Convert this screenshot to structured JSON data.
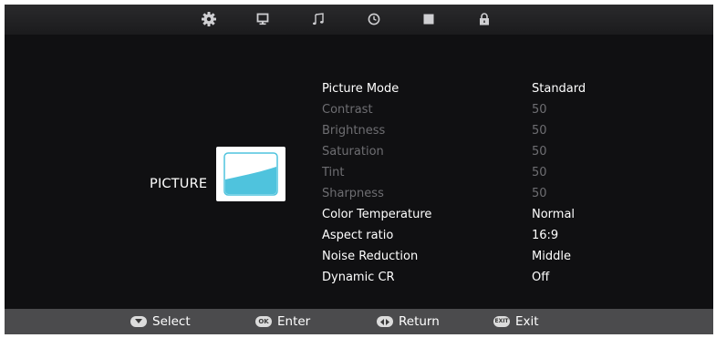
{
  "tabs": [
    {
      "name": "settings",
      "icon": "gear-icon"
    },
    {
      "name": "picture",
      "icon": "monitor-icon"
    },
    {
      "name": "sound",
      "icon": "music-note-icon"
    },
    {
      "name": "time",
      "icon": "clock-icon"
    },
    {
      "name": "channel",
      "icon": "square-icon"
    },
    {
      "name": "lock",
      "icon": "lock-icon"
    }
  ],
  "section": {
    "label": "PICTURE",
    "icon": "picture-thumbnail-icon"
  },
  "menu": [
    {
      "label": "Picture Mode",
      "value": "Standard",
      "enabled": true
    },
    {
      "label": "Contrast",
      "value": "50",
      "enabled": false
    },
    {
      "label": "Brightness",
      "value": "50",
      "enabled": false
    },
    {
      "label": "Saturation",
      "value": "50",
      "enabled": false
    },
    {
      "label": "Tint",
      "value": "50",
      "enabled": false
    },
    {
      "label": "Sharpness",
      "value": "50",
      "enabled": false
    },
    {
      "label": "Color Temperature",
      "value": "Normal",
      "enabled": true
    },
    {
      "label": "Aspect ratio",
      "value": "16:9",
      "enabled": true
    },
    {
      "label": "Noise Reduction",
      "value": "Middle",
      "enabled": true
    },
    {
      "label": "Dynamic CR",
      "value": "Off",
      "enabled": true
    }
  ],
  "hints": {
    "select": {
      "key_icon": "down-arrow-key-icon",
      "label": "Select"
    },
    "enter": {
      "key_text": "OK",
      "label": "Enter"
    },
    "return": {
      "key_icon": "left-right-key-icon",
      "label": "Return"
    },
    "exit": {
      "key_text": "EXIT",
      "label": "Exit"
    }
  },
  "colors": {
    "background": "#101012",
    "bottom_bar": "#4b4b4d",
    "accent_cyan": "#4fc3dd",
    "text_active": "#ffffff",
    "text_disabled": "#6e6e72"
  }
}
